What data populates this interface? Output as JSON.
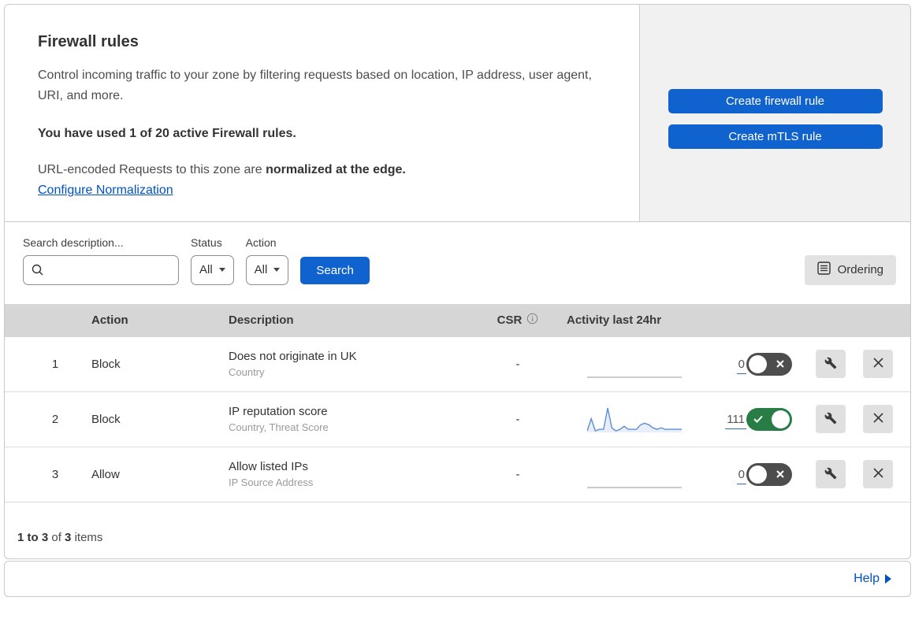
{
  "colors": {
    "primary_blue": "#1063ce",
    "link_blue": "#0051c3",
    "toggle_on_green": "#287c46",
    "toggle_off_gray": "#4d4d4d",
    "side_panel_gray": "#f1f1f1",
    "table_header_gray": "#d6d6d6",
    "sparkline_blue": "#5b8dd9"
  },
  "header": {
    "title": "Firewall rules",
    "description": "Control incoming traffic to your zone by filtering requests based on location, IP address, user agent, URI, and more.",
    "usage_bold": "You have used 1 of 20 active Firewall rules.",
    "normalization_text": "URL-encoded Requests to this zone are ",
    "normalization_bold": "normalized at the edge.",
    "configure_link": "Configure Normalization",
    "create_firewall_button": "Create firewall rule",
    "create_mtls_button": "Create mTLS rule"
  },
  "filters": {
    "search_label": "Search description...",
    "status_label": "Status",
    "status_value": "All",
    "action_label": "Action",
    "action_value": "All",
    "search_button": "Search",
    "ordering_button": "Ordering"
  },
  "table": {
    "headers": {
      "action": "Action",
      "description": "Description",
      "csr": "CSR",
      "activity": "Activity last 24hr"
    },
    "rows": [
      {
        "priority": "1",
        "action": "Block",
        "description": "Does not originate in UK",
        "fields": "Country",
        "csr": "-",
        "activity_count": "0",
        "enabled": false,
        "sparkline": [
          0,
          0,
          0,
          0,
          0,
          0,
          0,
          0,
          0,
          0,
          0,
          0,
          0,
          0,
          0,
          0,
          0,
          0,
          0,
          0,
          0,
          0,
          0,
          0
        ]
      },
      {
        "priority": "2",
        "action": "Block",
        "description": "IP reputation score",
        "fields": "Country, Threat Score",
        "csr": "-",
        "activity_count": "111",
        "enabled": true,
        "sparkline": [
          1,
          9,
          1,
          2,
          2,
          16,
          3,
          1,
          2,
          4,
          2,
          2,
          2,
          5,
          6,
          5,
          3,
          2,
          3,
          2,
          2,
          2,
          2,
          2
        ]
      },
      {
        "priority": "3",
        "action": "Allow",
        "description": "Allow listed IPs",
        "fields": "IP Source Address",
        "csr": "-",
        "activity_count": "0",
        "enabled": false,
        "sparkline": [
          0,
          0,
          0,
          0,
          0,
          0,
          0,
          0,
          0,
          0,
          0,
          0,
          0,
          0,
          0,
          0,
          0,
          0,
          0,
          0,
          0,
          0,
          0,
          0
        ]
      }
    ]
  },
  "footer": {
    "range_bold": "1 to 3",
    "of_text": "of",
    "total_bold": "3",
    "items_text": "items",
    "help_link": "Help"
  }
}
